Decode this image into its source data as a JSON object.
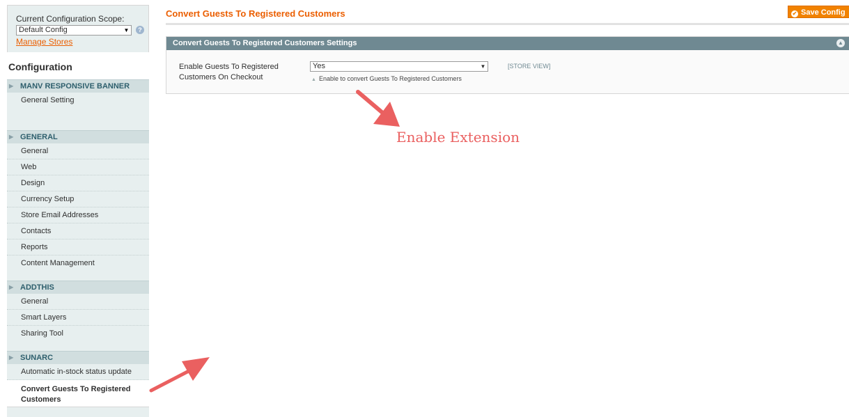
{
  "scope": {
    "label": "Current Configuration Scope:",
    "selected": "Default Config",
    "help_icon": "help-icon",
    "manage_stores": "Manage Stores"
  },
  "sidebar": {
    "title": "Configuration",
    "groups": [
      {
        "header": "MANV RESPONSIVE BANNER",
        "items": [
          "General Setting"
        ]
      },
      {
        "header": "GENERAL",
        "items": [
          "General",
          "Web",
          "Design",
          "Currency Setup",
          "Store Email Addresses",
          "Contacts",
          "Reports",
          "Content Management"
        ]
      },
      {
        "header": "ADDTHIS",
        "items": [
          "General",
          "Smart Layers",
          "Sharing Tool"
        ]
      },
      {
        "header": "SUNARC",
        "items": [
          "Automatic in-stock status update",
          "Convert Guests To Registered Customers"
        ]
      }
    ]
  },
  "main": {
    "title": "Convert Guests To Registered Customers",
    "save_label": "Save Config",
    "section": {
      "title": "Convert Guests To Registered Customers Settings",
      "field": {
        "label": "Enable Guests To Registered Customers On Checkout",
        "value": "Yes",
        "note": "Enable to convert Guests To Registered Customers",
        "scope": "[STORE VIEW]"
      }
    }
  },
  "annotation": {
    "text": "Enable Extension",
    "color": "#ea6060"
  },
  "colors": {
    "accent": "#eb5e00",
    "section_header": "#6f8992",
    "save_button": "#f18200"
  }
}
